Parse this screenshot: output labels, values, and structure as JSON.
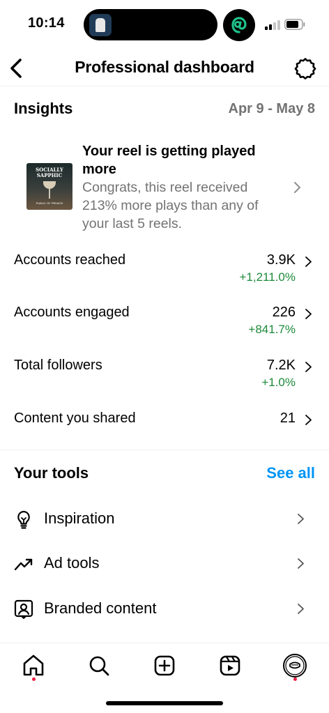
{
  "status_bar": {
    "time": "10:14"
  },
  "header": {
    "title": "Professional dashboard"
  },
  "insights": {
    "title": "Insights",
    "date_range": "Apr 9 - May 8",
    "reel_card": {
      "title": "Your reel is getting played more",
      "description": "Congrats, this reel received 213% more plays than any of your last 5 reels.",
      "thumb_text": "SOCIALLY SAPPHIC",
      "thumb_subtext": "PUBLIC OF PRIVATE"
    },
    "metrics": [
      {
        "label": "Accounts reached",
        "value": "3.9K",
        "change": "+1,211.0%"
      },
      {
        "label": "Accounts engaged",
        "value": "226",
        "change": "+841.7%"
      },
      {
        "label": "Total followers",
        "value": "7.2K",
        "change": "+1.0%"
      },
      {
        "label": "Content you shared",
        "value": "21",
        "change": ""
      }
    ]
  },
  "tools": {
    "title": "Your tools",
    "see_all": "See all",
    "items": [
      {
        "label": "Inspiration",
        "icon": "lightbulb-icon"
      },
      {
        "label": "Ad tools",
        "icon": "trending-up-icon"
      },
      {
        "label": "Branded content",
        "icon": "branded-content-icon"
      }
    ]
  },
  "tab_bar": {
    "tabs": [
      "home-icon",
      "search-icon",
      "create-icon",
      "reels-icon",
      "profile-avatar"
    ]
  },
  "colors": {
    "accent": "#0095f6",
    "positive": "#1c8a3a",
    "muted": "#737373",
    "notification_dot": "#ed1c43"
  }
}
